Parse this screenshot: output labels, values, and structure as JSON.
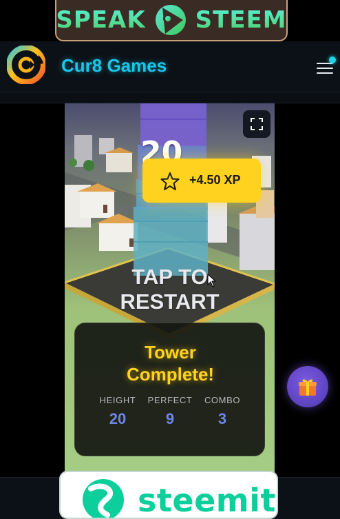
{
  "top_banner": {
    "left_word": "SPEAK",
    "right_word": "STEEM"
  },
  "header": {
    "site_title": "Cur8 Games",
    "menu_icon": "hamburger-menu-icon",
    "notification_color": "#22d3e6"
  },
  "game": {
    "score": "20",
    "xp_badge": {
      "text": "+4.50 XP",
      "icon": "star-icon"
    },
    "restart_line1": "TAP TO",
    "restart_line2": "RESTART",
    "result": {
      "title_line1": "Tower",
      "title_line2": "Complete!",
      "stats": [
        {
          "label": "HEIGHT",
          "value": "20"
        },
        {
          "label": "PERFECT",
          "value": "9"
        },
        {
          "label": "COMBO",
          "value": "3"
        }
      ]
    },
    "fullscreen_icon": "fullscreen-icon"
  },
  "floating": {
    "gift_icon": "gift-icon"
  },
  "bottom_banner": {
    "word": "steemit"
  },
  "colors": {
    "accent": "#19c7e8",
    "xp_yellow": "#ffd21f",
    "stat_blue": "#6f86e6",
    "steemit_green": "#0ccf9b"
  }
}
